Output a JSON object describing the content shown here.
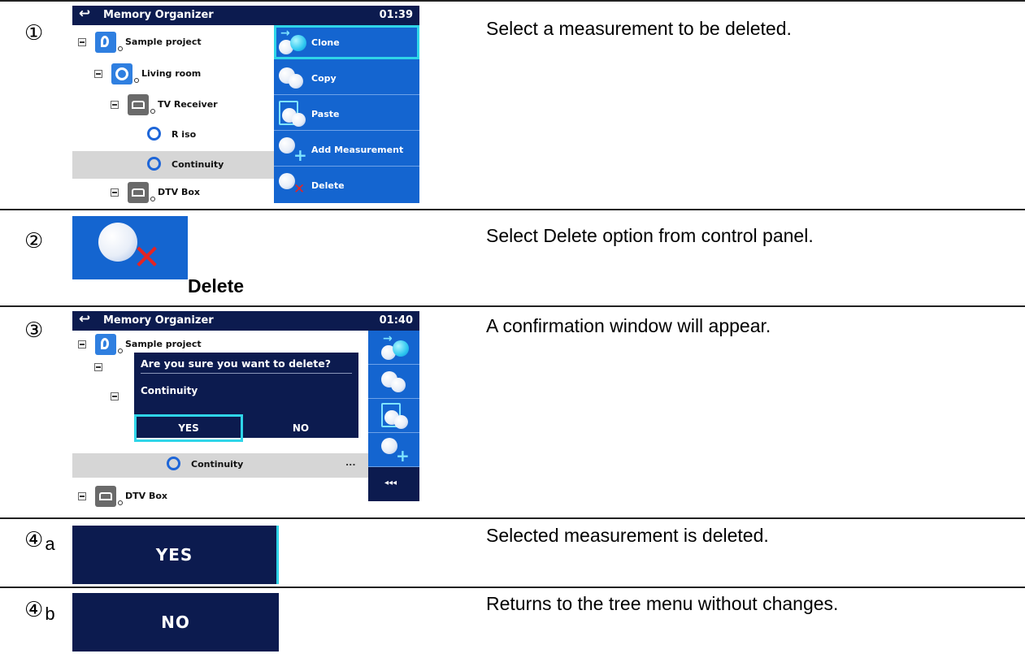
{
  "steps": [
    {
      "num": "①",
      "desc": "Select a measurement to be deleted."
    },
    {
      "num": "②",
      "desc": "Select Delete option from control panel."
    },
    {
      "num": "③",
      "desc": "A confirmation window will appear."
    },
    {
      "num": "④",
      "sub": "a",
      "desc": "Selected measurement is deleted."
    },
    {
      "num": "④",
      "sub": "b",
      "desc": "Returns to the tree menu without changes."
    }
  ],
  "screen1": {
    "title": "Memory Organizer",
    "time": "01:39",
    "tree": [
      "Sample project",
      "Living room",
      "TV Receiver",
      "R iso",
      "Continuity",
      "DTV Box"
    ],
    "panel": [
      "Clone",
      "Copy",
      "Paste",
      "Add Measurement",
      "Delete"
    ]
  },
  "step2": {
    "label": "Delete"
  },
  "screen3": {
    "title": "Memory Organizer",
    "time": "01:40",
    "tree_project": "Sample project",
    "tree_cont": "Continuity",
    "tree_dtv": "DTV Box",
    "dialog_question": "Are you sure you want to delete?",
    "dialog_item": "Continuity",
    "yes": "YES",
    "no": "NO",
    "more": "◂◂◂"
  },
  "step4a": {
    "button": "YES"
  },
  "step4b": {
    "button": "NO"
  },
  "colors": {
    "titlebar": "#0c1b4f",
    "panel": "#1465d0",
    "highlight": "#2fd5e8",
    "delete_x": "#e42424"
  }
}
